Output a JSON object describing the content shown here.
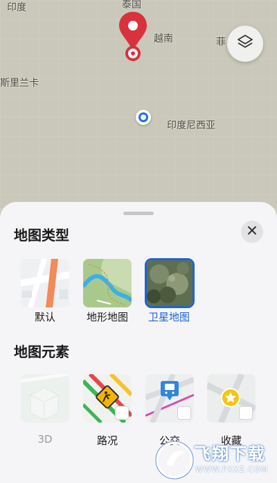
{
  "map": {
    "labels": {
      "india": "印度",
      "thailand": "泰国",
      "vietnam": "越南",
      "philippines": "菲",
      "sri_lanka": "斯里兰卡",
      "indonesia": "印度尼西亚"
    },
    "pin_color": "#d9313e",
    "location_color": "#1f6fe0"
  },
  "sheet": {
    "map_type_title": "地图类型",
    "map_types": [
      {
        "label": "默认",
        "selected": false
      },
      {
        "label": "地形地图",
        "selected": false
      },
      {
        "label": "卫星地图",
        "selected": true
      }
    ],
    "elements_title": "地图元素",
    "elements": [
      {
        "label": "3D",
        "enabled": false
      },
      {
        "label": "路况",
        "enabled": true
      },
      {
        "label": "公交",
        "enabled": true
      },
      {
        "label": "收藏",
        "enabled": true
      }
    ],
    "accent": "#1b63d8"
  },
  "watermark": {
    "main": "飞翔下载",
    "sub": "WWW.FXXZ.COM"
  }
}
